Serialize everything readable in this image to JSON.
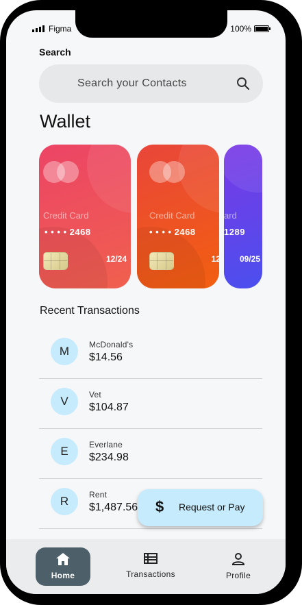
{
  "status_bar": {
    "carrier": "Figma",
    "battery": "100%"
  },
  "search": {
    "label": "Search",
    "placeholder": "Search your Contacts"
  },
  "wallet": {
    "title": "Wallet",
    "cards": [
      {
        "type": "Credit Card",
        "number": "• • • •  2468",
        "expiry": "12/24",
        "colors": [
          "#ec4466",
          "#f0604e"
        ]
      },
      {
        "type": "Credit Card",
        "number": "• • • •  2468",
        "expiry": "12",
        "colors": [
          "#e9463a",
          "#f25f10"
        ]
      },
      {
        "type": "ard",
        "number": "1289",
        "expiry": "09/25",
        "colors": [
          "#7a39e6",
          "#4b4fee"
        ]
      }
    ]
  },
  "recent": {
    "title": "Recent Transactions",
    "items": [
      {
        "initial": "M",
        "name": "McDonald's",
        "amount": "$14.56"
      },
      {
        "initial": "V",
        "name": "Vet",
        "amount": "$104.87"
      },
      {
        "initial": "E",
        "name": "Everlane",
        "amount": "$234.98"
      },
      {
        "initial": "R",
        "name": "Rent",
        "amount": "$1,487.56"
      }
    ]
  },
  "fab": {
    "label": "Request or Pay",
    "icon": "$"
  },
  "nav": {
    "items": [
      {
        "label": "Home",
        "icon": "home-icon",
        "active": true
      },
      {
        "label": "Transactions",
        "icon": "list-icon",
        "active": false
      },
      {
        "label": "Profile",
        "icon": "person-icon",
        "active": false
      }
    ]
  },
  "colors": {
    "accent": "#c5ebfd",
    "nav_active": "#4d5f68",
    "background": "#f6f7f9"
  }
}
